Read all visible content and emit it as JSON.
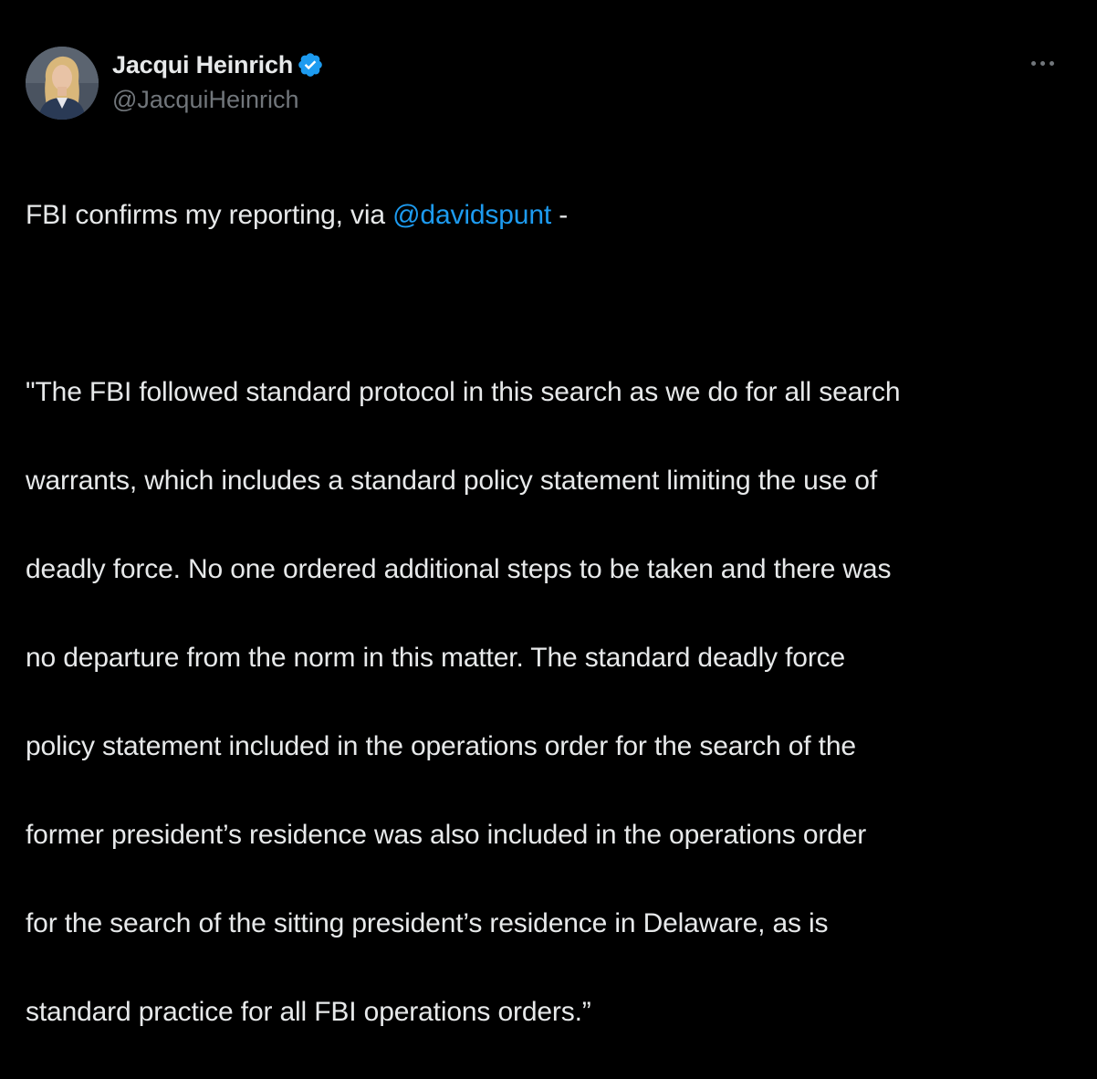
{
  "author": {
    "display_name": "Jacqui Heinrich",
    "handle": "@JacquiHeinrich",
    "verified": true,
    "avatar_icon": "profile-photo"
  },
  "menu": {
    "more_icon": "ellipsis-icon"
  },
  "colors": {
    "background": "#000000",
    "text": "#e7e9ea",
    "secondary": "#71767b",
    "accent": "#1d9bf0"
  },
  "tweet": {
    "intro_before": "FBI confirms my reporting, via ",
    "mention": "@davidspunt",
    "intro_after": " -",
    "quote_lines": [
      "\"The FBI followed standard protocol in this search as we do for all search",
      "warrants, which includes a standard policy statement limiting the use of",
      "deadly force. No one ordered additional steps to be taken and there was",
      "no departure from the norm in this matter.  The standard deadly force",
      "policy statement included in the operations order for the search of the",
      "former president’s residence was also included in the operations order",
      "for the search of the sitting president’s residence in Delaware, as is",
      "standard practice for all FBI operations orders.”"
    ]
  }
}
